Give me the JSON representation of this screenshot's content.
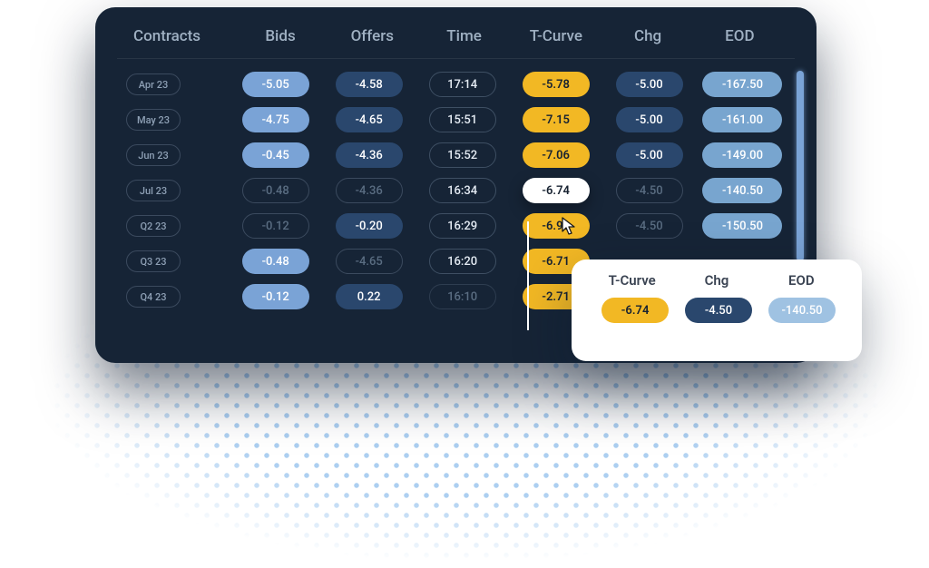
{
  "headers": {
    "contracts": "Contracts",
    "bids": "Bids",
    "offers": "Offers",
    "time": "Time",
    "tcurve": "T-Curve",
    "chg": "Chg",
    "eod": "EOD"
  },
  "rows": [
    {
      "contract": "Apr 23",
      "bid": "-5.05",
      "bid_dim": false,
      "offer": "-4.58",
      "offer_dim": false,
      "time": "17:14",
      "time_dim": false,
      "tcurve": "-5.78",
      "tcurve_hover": false,
      "chg": "-5.00",
      "chg_dim": false,
      "eod": "-167.50"
    },
    {
      "contract": "May 23",
      "bid": "-4.75",
      "bid_dim": false,
      "offer": "-4.65",
      "offer_dim": false,
      "time": "15:51",
      "time_dim": false,
      "tcurve": "-7.15",
      "tcurve_hover": false,
      "chg": "-5.00",
      "chg_dim": false,
      "eod": "-161.00"
    },
    {
      "contract": "Jun 23",
      "bid": "-0.45",
      "bid_dim": false,
      "offer": "-4.36",
      "offer_dim": false,
      "time": "15:52",
      "time_dim": false,
      "tcurve": "-7.06",
      "tcurve_hover": false,
      "chg": "-5.00",
      "chg_dim": false,
      "eod": "-149.00"
    },
    {
      "contract": "Jul 23",
      "bid": "-0.48",
      "bid_dim": true,
      "offer": "-4.36",
      "offer_dim": true,
      "time": "16:34",
      "time_dim": false,
      "tcurve": "-6.74",
      "tcurve_hover": true,
      "chg": "-4.50",
      "chg_dim": true,
      "eod": "-140.50"
    },
    {
      "contract": "Q2 23",
      "bid": "-0.12",
      "bid_dim": true,
      "offer": "-0.20",
      "offer_dim": false,
      "time": "16:29",
      "time_dim": false,
      "tcurve": "-6.98",
      "tcurve_hover": false,
      "chg": "-4.50",
      "chg_dim": true,
      "eod": "-150.50"
    },
    {
      "contract": "Q3 23",
      "bid": "-0.48",
      "bid_dim": false,
      "offer": "-4.65",
      "offer_dim": true,
      "time": "16:20",
      "time_dim": false,
      "tcurve": "-6.71",
      "tcurve_hover": false,
      "chg": "",
      "chg_dim": true,
      "eod": ""
    },
    {
      "contract": "Q4 23",
      "bid": "-0.12",
      "bid_dim": false,
      "offer": "0.22",
      "offer_dim": false,
      "time": "16:10",
      "time_dim": true,
      "tcurve": "-2.71",
      "tcurve_hover": false,
      "chg": "",
      "chg_dim": true,
      "eod": ""
    }
  ],
  "popover": {
    "headers": {
      "tcurve": "T-Curve",
      "chg": "Chg",
      "eod": "EOD"
    },
    "values": {
      "tcurve": "-6.74",
      "chg": "-4.50",
      "eod": "-140.50"
    }
  }
}
